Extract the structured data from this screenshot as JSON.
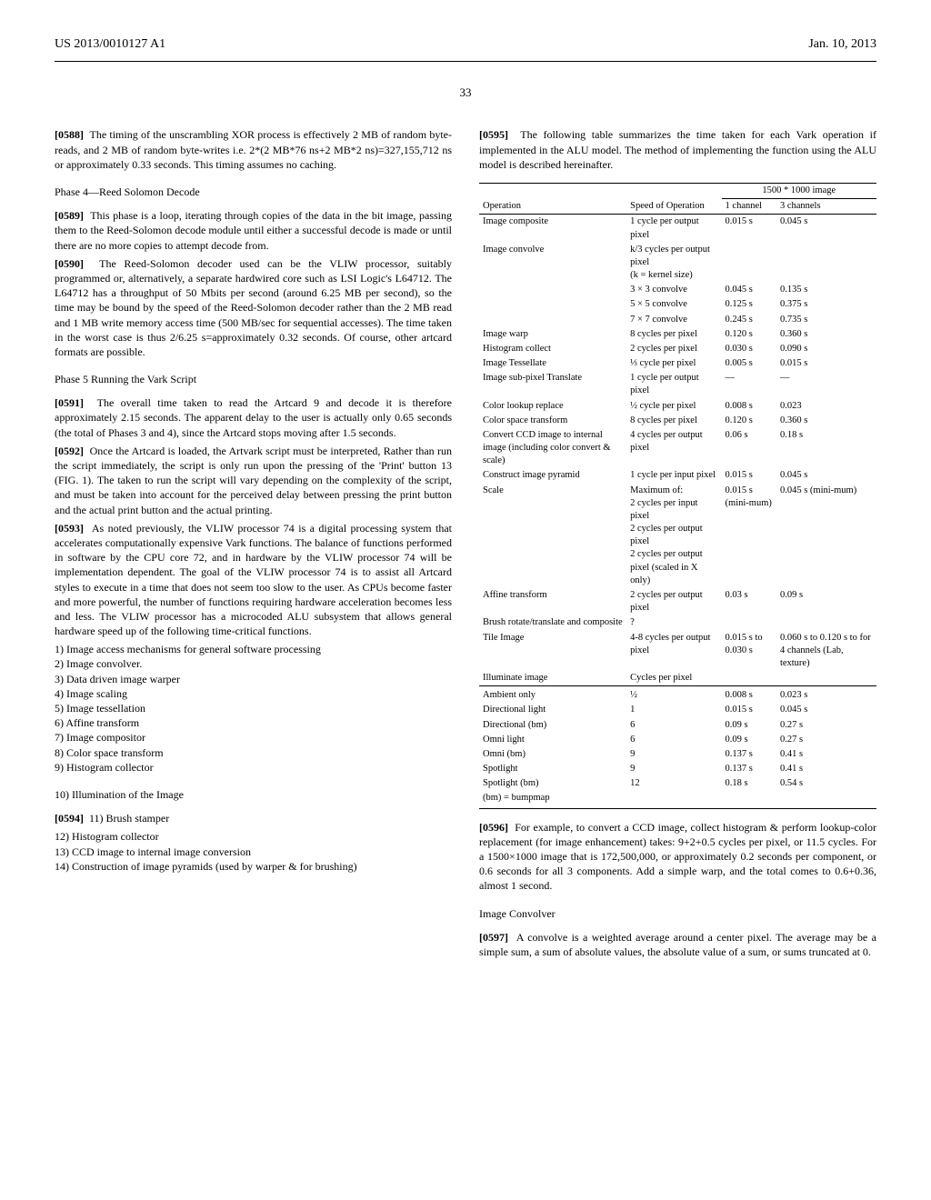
{
  "header": {
    "left": "US 2013/0010127 A1",
    "right": "Jan. 10, 2013"
  },
  "page_number": "33",
  "left_col": {
    "p0588": {
      "label": "[0588]",
      "text": "The timing of the unscrambling XOR process is effectively 2 MB of random byte-reads, and 2 MB of random byte-writes i.e. 2*(2 MB*76 ns+2 MB*2 ns)=327,155,712 ns or approximately 0.33 seconds. This timing assumes no caching."
    },
    "phase4_heading": "Phase 4—Reed Solomon Decode",
    "p0589": {
      "label": "[0589]",
      "text": "This phase is a loop, iterating through copies of the data in the bit image, passing them to the Reed-Solomon decode module until either a successful decode is made or until there are no more copies to attempt decode from."
    },
    "p0590": {
      "label": "[0590]",
      "text": "The Reed-Solomon decoder used can be the VLIW processor, suitably programmed or, alternatively, a separate hardwired core such as LSI Logic's L64712. The L64712 has a throughput of 50 Mbits per second (around 6.25 MB per second), so the time may be bound by the speed of the Reed-Solomon decoder rather than the 2 MB read and 1 MB write memory access time (500 MB/sec for sequential accesses). The time taken in the worst case is thus 2/6.25 s=approximately 0.32 seconds. Of course, other artcard formats are possible."
    },
    "phase5_heading": "Phase 5 Running the Vark Script",
    "p0591": {
      "label": "[0591]",
      "text": "The overall time taken to read the Artcard 9 and decode it is therefore approximately 2.15 seconds. The apparent delay to the user is actually only 0.65 seconds (the total of Phases 3 and 4), since the Artcard stops moving after 1.5 seconds."
    },
    "p0592": {
      "label": "[0592]",
      "text": "Once the Artcard is loaded, the Artvark script must be interpreted, Rather than run the script immediately, the script is only run upon the pressing of the 'Print' button 13 (FIG. 1). The taken to run the script will vary depending on the complexity of the script, and must be taken into account for the perceived delay between pressing the print button and the actual print button and the actual printing."
    },
    "p0593": {
      "label": "[0593]",
      "text": "As noted previously, the VLIW processor 74 is a digital processing system that accelerates computationally expensive Vark functions. The balance of functions performed in software by the CPU core 72, and in hardware by the VLIW processor 74 will be implementation dependent. The goal of the VLIW processor 74 is to assist all Artcard styles to execute in a time that does not seem too slow to the user. As CPUs become faster and more powerful, the number of functions requiring hardware acceleration becomes less and less. The VLIW processor has a microcoded ALU subsystem that allows general hardware speed up of the following time-critical functions."
    },
    "list1": [
      "1) Image access mechanisms for general software processing",
      "2) Image convolver.",
      "3) Data driven image warper",
      "4) Image scaling",
      "5) Image tessellation",
      "6) Affine transform",
      "7) Image compositor",
      "8) Color space transform",
      "9) Histogram collector"
    ],
    "illum_heading": "10) Illumination of the Image",
    "p0594": {
      "label": "[0594]",
      "text": "11) Brush stamper"
    },
    "list2": [
      "12) Histogram collector",
      "13) CCD image to internal image conversion",
      "14) Construction of image pyramids (used by warper & for brushing)"
    ]
  },
  "right_col": {
    "p0595": {
      "label": "[0595]",
      "text": "The following table summarizes the time taken for each Vark operation if implemented in the ALU model. The method of implementing the function using the ALU model is described hereinafter."
    },
    "p0596": {
      "label": "[0596]",
      "text": "For example, to convert a CCD image, collect histogram & perform lookup-color replacement (for image enhancement) takes: 9+2+0.5 cycles per pixel, or 11.5 cycles. For a 1500×1000 image that is 172,500,000, or approximately 0.2 seconds per component, or 0.6 seconds for all 3 components. Add a simple warp, and the total comes to 0.6+0.36, almost 1 second."
    },
    "convolver_heading": "Image Convolver",
    "p0597": {
      "label": "[0597]",
      "text": "A convolve is a weighted average around a center pixel. The average may be a simple sum, a sum of absolute values, the absolute value of a sum, or sums truncated at 0."
    }
  },
  "chart_data": {
    "type": "table",
    "title_span": "1500 * 1000 image",
    "columns": [
      "Operation",
      "Speed of Operation",
      "1 channel",
      "3 channels"
    ],
    "rows": [
      {
        "op": "Image composite",
        "speed": "1 cycle per output pixel",
        "c1": "0.015 s",
        "c3": "0.045 s"
      },
      {
        "op": "Image convolve",
        "speed": "k/3 cycles per output pixel\n(k = kernel size)",
        "c1": "",
        "c3": ""
      },
      {
        "op": "",
        "speed": "3 × 3 convolve",
        "c1": "0.045 s",
        "c3": "0.135 s"
      },
      {
        "op": "",
        "speed": "5 × 5 convolve",
        "c1": "0.125 s",
        "c3": "0.375 s"
      },
      {
        "op": "",
        "speed": "7 × 7 convolve",
        "c1": "0.245 s",
        "c3": "0.735 s"
      },
      {
        "op": "Image warp",
        "speed": "8 cycles per pixel",
        "c1": "0.120 s",
        "c3": "0.360 s"
      },
      {
        "op": "Histogram collect",
        "speed": "2 cycles per pixel",
        "c1": "0.030 s",
        "c3": "0.090 s"
      },
      {
        "op": "Image Tessellate",
        "speed": "⅓ cycle per pixel",
        "c1": "0.005 s",
        "c3": "0.015 s"
      },
      {
        "op": "Image sub-pixel Translate",
        "speed": "1 cycle per output pixel",
        "c1": "—",
        "c3": "—"
      },
      {
        "op": "Color lookup replace",
        "speed": "½ cycle per pixel",
        "c1": "0.008 s",
        "c3": "0.023"
      },
      {
        "op": "Color space transform",
        "speed": "8 cycles per pixel",
        "c1": "0.120 s",
        "c3": "0.360 s"
      },
      {
        "op": "Convert CCD image to internal image (including color convert & scale)",
        "speed": "4 cycles per output pixel",
        "c1": "0.06 s",
        "c3": "0.18 s"
      },
      {
        "op": "Construct image pyramid",
        "speed": "1 cycle per input pixel",
        "c1": "0.015 s",
        "c3": "0.045 s"
      },
      {
        "op": "Scale",
        "speed": "Maximum of:\n2 cycles per input pixel\n2 cycles per output pixel\n2 cycles per output pixel (scaled in X only)",
        "c1": "0.015 s (mini-mum)",
        "c3": "0.045 s (mini-mum)"
      },
      {
        "op": "Affine transform",
        "speed": "2 cycles per output pixel",
        "c1": "0.03 s",
        "c3": "0.09 s"
      },
      {
        "op": "Brush rotate/translate and composite",
        "speed": "?",
        "c1": "",
        "c3": ""
      },
      {
        "op": "Tile Image",
        "speed": "4-8 cycles per output pixel",
        "c1": "0.015 s to 0.030 s",
        "c3": "0.060 s to 0.120 s to for 4 channels (Lab, texture)"
      },
      {
        "op": "Illuminate image",
        "speed": "Cycles per pixel",
        "c1": "",
        "c3": ""
      }
    ],
    "illum_rows": [
      {
        "op": "Ambient only",
        "speed": "½",
        "c1": "0.008 s",
        "c3": "0.023 s"
      },
      {
        "op": "Directional light",
        "speed": "1",
        "c1": "0.015 s",
        "c3": "0.045 s"
      },
      {
        "op": "Directional (bm)",
        "speed": "6",
        "c1": "0.09 s",
        "c3": "0.27 s"
      },
      {
        "op": "Omni light",
        "speed": "6",
        "c1": "0.09 s",
        "c3": "0.27 s"
      },
      {
        "op": "Omni (bm)",
        "speed": "9",
        "c1": "0.137 s",
        "c3": "0.41 s"
      },
      {
        "op": "Spotlight",
        "speed": "9",
        "c1": "0.137 s",
        "c3": "0.41 s"
      },
      {
        "op": "Spotlight (bm)",
        "speed": "12",
        "c1": "0.18 s",
        "c3": "0.54 s"
      },
      {
        "op": "(bm) = bumpmap",
        "speed": "",
        "c1": "",
        "c3": ""
      }
    ]
  }
}
